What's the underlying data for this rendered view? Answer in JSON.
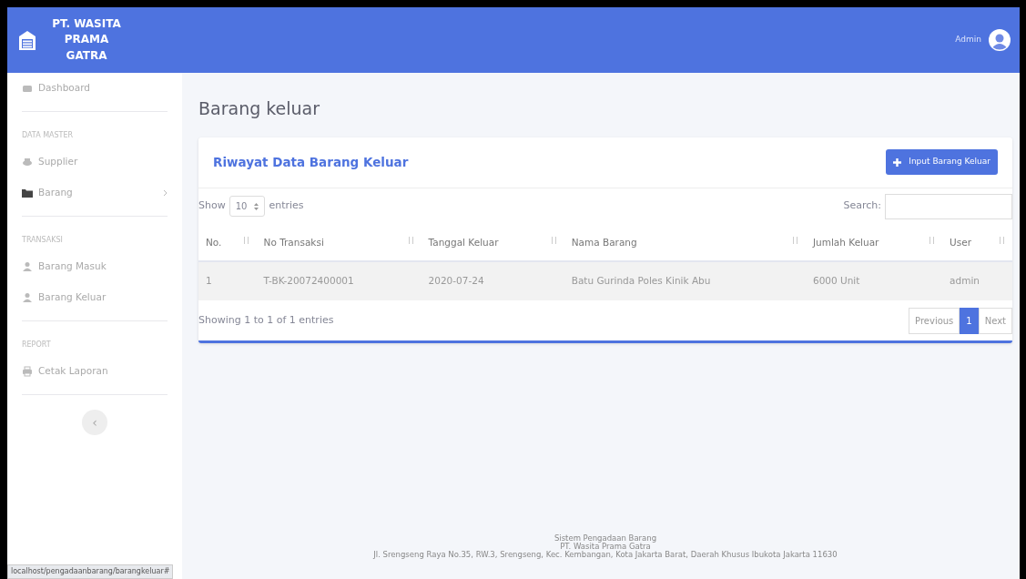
{
  "brand": {
    "lines": [
      "PT. WASITA",
      "PRAMA",
      "GATRA"
    ]
  },
  "topbar": {
    "user": "Admin"
  },
  "sidebar": {
    "items": [
      {
        "kind": "link",
        "label": "Dashboard"
      },
      {
        "kind": "divider"
      },
      {
        "kind": "heading",
        "label": "DATA MASTER"
      },
      {
        "kind": "link",
        "label": "Supplier"
      },
      {
        "kind": "link",
        "label": "Barang",
        "expandable": true
      },
      {
        "kind": "divider"
      },
      {
        "kind": "heading",
        "label": "TRANSAKSI"
      },
      {
        "kind": "link",
        "label": "Barang Masuk"
      },
      {
        "kind": "link",
        "label": "Barang Keluar"
      },
      {
        "kind": "divider"
      },
      {
        "kind": "heading",
        "label": "REPORT"
      },
      {
        "kind": "link",
        "label": "Cetak Laporan"
      },
      {
        "kind": "divider"
      }
    ],
    "toggle": "‹"
  },
  "page_title": "Barang keluar",
  "card": {
    "title": "Riwayat Data Barang Keluar",
    "add_button": "Input Barang Keluar",
    "length": {
      "before": "Show",
      "value": "10",
      "after": "entries"
    },
    "search_label": "Search:",
    "table": {
      "columns": [
        "No.",
        "No Transaksi",
        "Tanggal Keluar",
        "Nama Barang",
        "Jumlah Keluar",
        "User"
      ],
      "rows": [
        [
          "1",
          "T-BK-20072400001",
          "2020-07-24",
          "Batu Gurinda Poles Kinik Abu",
          "6000 Unit",
          "admin"
        ]
      ]
    },
    "info": "Showing 1 to 1 of 1 entries",
    "pagination": [
      {
        "label": "Previous",
        "selected": false
      },
      {
        "label": "1",
        "selected": true
      },
      {
        "label": "Next",
        "selected": false
      }
    ]
  },
  "footer": [
    "Sistem Pengadaan Barang",
    "PT. Wasita Prama Gatra",
    "Jl. Srengseng Raya No.35, RW.3, Srengseng, Kec. Kembangan, Kota Jakarta Barat, Daerah Khusus Ibukota Jakarta 11630"
  ],
  "status_url": "localhost/pengadaanbarang/barangkeluar#"
}
